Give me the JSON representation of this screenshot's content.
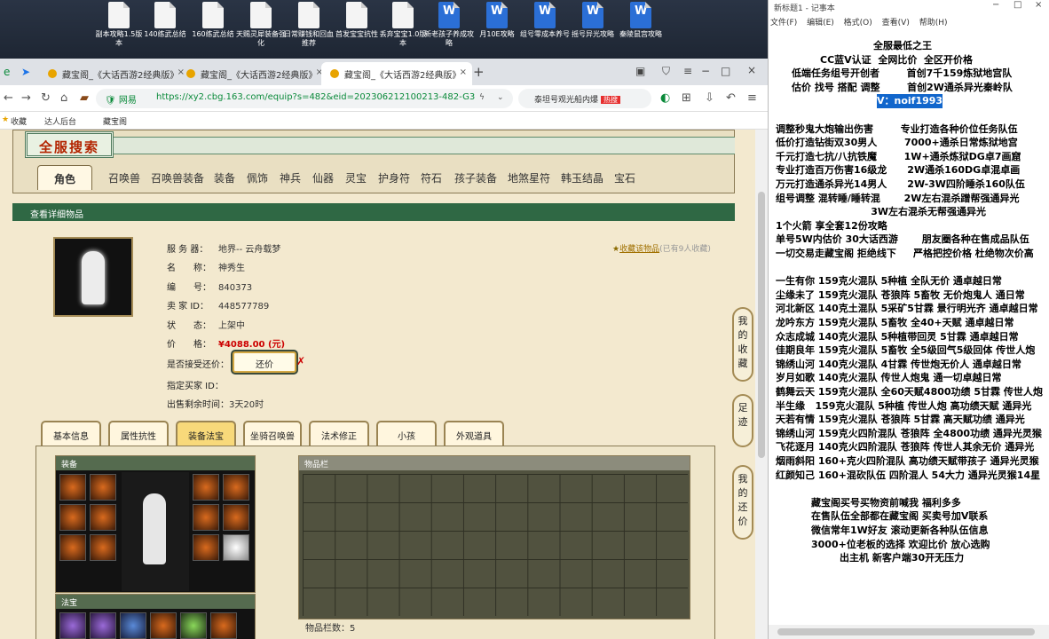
{
  "desktop": {
    "icons": [
      {
        "label": "副本攻略1.5版本",
        "type": "doc"
      },
      {
        "label": "140练武总结",
        "type": "doc"
      },
      {
        "label": "160练武总结",
        "type": "doc"
      },
      {
        "label": "天赐灵犀装备强化",
        "type": "doc"
      },
      {
        "label": "日常赚钱和回血推荐",
        "type": "doc"
      },
      {
        "label": "首发宝宝抗性",
        "type": "doc"
      },
      {
        "label": "丢弃宝宝1.0版本",
        "type": "doc"
      },
      {
        "label": "新老孩子养成攻略",
        "type": "word"
      },
      {
        "label": "月10E攻略",
        "type": "word"
      },
      {
        "label": "组号零成本养号",
        "type": "word"
      },
      {
        "label": "摇号异光攻略",
        "type": "word"
      },
      {
        "label": "秦陵鼠宫攻略",
        "type": "word"
      }
    ]
  },
  "browser": {
    "tabs": [
      {
        "label": "藏宝阁_《大话西游2经典版》"
      },
      {
        "label": "藏宝阁_《大话西游2经典版》"
      },
      {
        "label": "藏宝阁_《大话西游2经典版》"
      }
    ],
    "new_tab": "+",
    "url_security": "网易",
    "url": "https://xy2.cbg.163.com/equip?s=482&eid=202306212100213-482-G3",
    "search_text": "泰坦号观光船内爆",
    "search_badge": "热搜",
    "bookmarks": [
      "收藏",
      "达人后台",
      "藏宝阁"
    ]
  },
  "page": {
    "title": "全服搜索",
    "categories": [
      "角色",
      "召唤兽",
      "召唤兽装备",
      "装备",
      "佩饰",
      "神兵",
      "仙器",
      "灵宝",
      "护身符",
      "符石",
      "孩子装备",
      "地煞星符",
      "韩玉结晶",
      "宝石"
    ],
    "detail_header": "查看详细物品",
    "fields": {
      "server_label": "服 务 器：",
      "server": "地界-- 云舟载梦",
      "name_label": "名　　称：",
      "name": "神秀生",
      "id_label": "编　　号：",
      "id": "840373",
      "seller_label": "卖 家 ID：",
      "seller": "448577789",
      "status_label": "状　　态：",
      "status": "上架中",
      "price_label": "价　　格：",
      "price": "¥4088.00 (元)",
      "counter_label": "是否接受还价：",
      "counter_btn": "还价",
      "buyer_label": "指定买家 ID：",
      "buyer": "",
      "time_label": "出售剩余时间：",
      "time": "3天20时"
    },
    "favorite": {
      "link": "收藏该物品",
      "count": "(已有9人收藏)"
    },
    "sub_tabs": [
      "基本信息",
      "属性抗性",
      "装备法宝",
      "坐骑召唤兽",
      "法术修正",
      "小孩",
      "外观道具"
    ],
    "active_sub_tab": 2,
    "equip_title": "装备",
    "fabao_title": "法宝",
    "bag_title": "物品栏",
    "bag_count": "物品栏数：5",
    "side_buttons": [
      "我的收藏",
      "足迹",
      "我的还价"
    ]
  },
  "notepad": {
    "title": "新标题1 - 记事本",
    "menu": [
      "文件(F)",
      "编辑(E)",
      "格式(O)",
      "查看(V)",
      "帮助(H)"
    ],
    "lines": [
      {
        "t": "全服最低之王"
      },
      {
        "t": "CC蓝V认证  全网比价  全区开价格"
      },
      {
        "t": "低端任务组号开创者        首创7千159炼狱地宫队"
      },
      {
        "t": "估价 找号 搭配 调整        首创2W通杀异光秦岭队"
      },
      {
        "t": "V：noif1993",
        "hl": true
      },
      {
        "t": ""
      },
      {
        "t": "调整秒鬼大炮输出伤害        专业打造各种价位任务队伍"
      },
      {
        "t": "低价打造钻街双30男人        7000+通杀日常炼狱地宫"
      },
      {
        "t": "千元打造七抗/八抗铁魔        1W+通杀炼狱DG卓7画窟"
      },
      {
        "t": "专业打造百万伤害16级龙      2W通杀160DG卓混卓画"
      },
      {
        "t": "万元打造通杀异光14男人      2W-3W四阶睡杀160队伍"
      },
      {
        "t": "组号调整 混转睡/睡转混       2W左右混杀蹭帮强通异光"
      },
      {
        "t": "                            3W左右混杀无帮强通异光"
      },
      {
        "t": "1个火箭 享全套12份攻略"
      },
      {
        "t": "单号5W内估价 30大话西游       朋友圈各种在售成品队伍"
      },
      {
        "t": "一切交易走藏宝阁 拒绝线下     严格把控价格 杜绝物次价高"
      },
      {
        "t": ""
      },
      {
        "t": "一生有你 159克火混队 5种植 全队无价 通卓越日常"
      },
      {
        "t": "尘缘未了 159克火混队 苍狼阵 5畜牧 无价炮鬼人 通日常"
      },
      {
        "t": "河北新区 140克土混队 5采矿5甘霖 景行明光齐 通卓越日常"
      },
      {
        "t": "龙吟东方 159克火混队 5畜牧 全40+天赋 通卓越日常"
      },
      {
        "t": "众志成城 140克火混队 5种植带回灵 5甘霖 通卓越日常"
      },
      {
        "t": "佳期良年 159克火混队 5畜牧 全5级回气5级回体 传世人炮"
      },
      {
        "t": "锦绣山河 140克火混队 4甘霖 传世炮无价人 通卓越日常"
      },
      {
        "t": "岁月如歌 140克火混队 传世人炮鬼 通一切卓越日常"
      },
      {
        "t": "鹤舞云天 159克火混队 全60天赋4800功绩 5甘霖 传世人炮"
      },
      {
        "t": "半生缘   159克火混队 5种植 传世人炮 高功绩天赋 通异光"
      },
      {
        "t": "天若有情 159克火混队 苍狼阵 5甘霖 高天赋功绩 通异光"
      },
      {
        "t": "锦绣山河 159克火四阶混队 苍狼阵 全4800功绩 通异光灵猴"
      },
      {
        "t": "飞花逐月 140克火四阶混队 苍狼阵 传世人其余无价 通异光"
      },
      {
        "t": "烟雨斜阳 160+克火四阶混队 高功绩天赋带孩子 通异光灵猴"
      },
      {
        "t": "红颜知己 160+混砍队伍 四阶混人 54大力 通异光灵猴14星"
      },
      {
        "t": ""
      },
      {
        "t": "藏宝阁买号买物资前喊我 福利多多"
      },
      {
        "t": "在售队伍全部都在藏宝阁 买卖号加V联系"
      },
      {
        "t": "微信常年1W好友 滚动更新各种队伍信息"
      },
      {
        "t": "3000+位老板的选择 欢迎比价 放心选购"
      },
      {
        "t": "出主机 新客户端30开无压力"
      }
    ]
  }
}
